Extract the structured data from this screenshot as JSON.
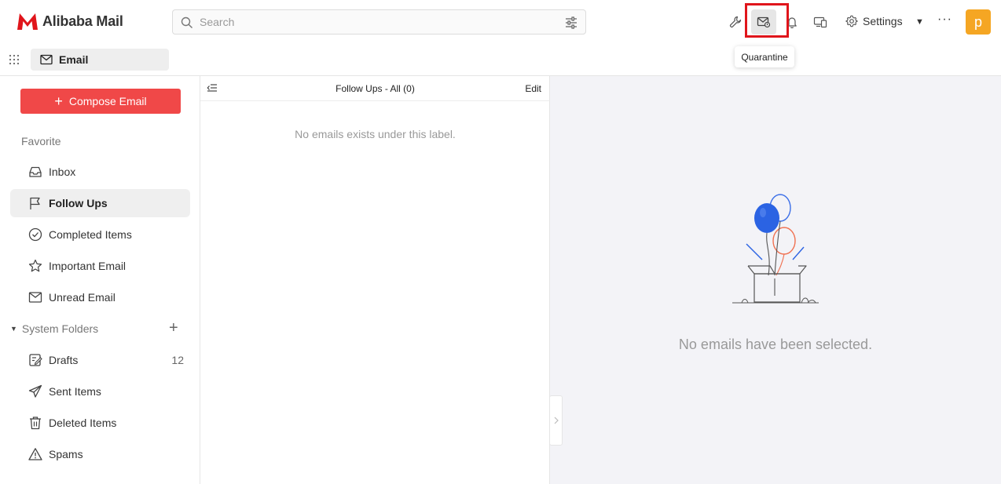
{
  "app": {
    "logo_text": "Alibaba Mail",
    "brand_color": "#e0151b"
  },
  "search": {
    "placeholder": "Search",
    "value": ""
  },
  "toolbar": {
    "settings_label": "Settings",
    "avatar_letter": "p",
    "tooltip": "Quarantine",
    "icons": [
      "wrench-icon",
      "quarantine-icon",
      "bell-icon",
      "devices-icon",
      "gear-icon",
      "more-icon"
    ]
  },
  "module_tab": {
    "label": "Email"
  },
  "sidebar": {
    "compose_label": "Compose Email",
    "favorite_label": "Favorite",
    "favorites": [
      {
        "label": "Inbox",
        "icon": "inbox-icon"
      },
      {
        "label": "Follow Ups",
        "icon": "flag-icon",
        "active": true
      },
      {
        "label": "Completed Items",
        "icon": "check-circle-icon"
      },
      {
        "label": "Important Email",
        "icon": "star-icon"
      },
      {
        "label": "Unread Email",
        "icon": "envelope-icon"
      }
    ],
    "system_folders_label": "System Folders",
    "system_folders": [
      {
        "label": "Drafts",
        "icon": "drafts-icon",
        "count": "12"
      },
      {
        "label": "Sent Items",
        "icon": "send-icon"
      },
      {
        "label": "Deleted Items",
        "icon": "trash-icon"
      },
      {
        "label": "Spams",
        "icon": "warning-icon"
      }
    ]
  },
  "list_pane": {
    "title": "Follow Ups - All (0)",
    "edit_label": "Edit",
    "empty_message": "No emails exists under this label."
  },
  "reading_pane": {
    "empty_message": "No emails have been selected."
  }
}
